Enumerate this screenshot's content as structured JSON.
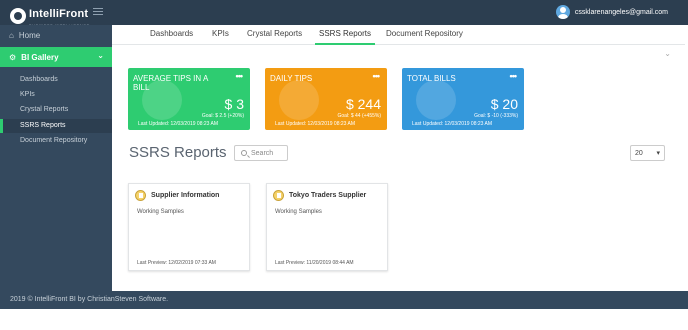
{
  "app": {
    "logo_text": "IntelliFront",
    "logo_sub": "BUSINESS INTELLIGENCE",
    "user_email": "cssklarenangeles@gmail.com"
  },
  "sidebar": {
    "home_label": "Home",
    "gallery_label": "BI Gallery",
    "items": [
      {
        "label": "Dashboards"
      },
      {
        "label": "KPIs"
      },
      {
        "label": "Crystal Reports"
      },
      {
        "label": "SSRS Reports"
      },
      {
        "label": "Document Repository"
      }
    ]
  },
  "tabs": [
    {
      "label": "Dashboards"
    },
    {
      "label": "KPIs"
    },
    {
      "label": "Crystal Reports"
    },
    {
      "label": "SSRS Reports"
    },
    {
      "label": "Document Repository"
    }
  ],
  "kpis": [
    {
      "title": "Average Tips in a Bill",
      "value": "$ 3",
      "goal": "Goal: $ 2.5 (+20%)",
      "updated": "Last Updated: 12/03/2019 08:23 AM",
      "color": "#2ecc71"
    },
    {
      "title": "Daily Tips",
      "value": "$ 244",
      "goal": "Goal: $ 44 (+455%)",
      "updated": "Last Updated: 12/03/2019 08:23 AM",
      "color": "#f39c12"
    },
    {
      "title": "Total Bills",
      "value": "$ 20",
      "goal": "Goal: $ -10 (-333%)",
      "updated": "Last Updated: 12/03/2019 08:23 AM",
      "color": "#3498db"
    }
  ],
  "section": {
    "title": "SSRS Reports",
    "search_placeholder": "Search",
    "page_size": "20"
  },
  "reports": [
    {
      "name": "Supplier Information",
      "description": "Working Samples",
      "last_preview": "Last Preview: 12/02/2019 07:33 AM"
    },
    {
      "name": "Tokyo Traders Supplier",
      "description": "Working Samples",
      "last_preview": "Last Preview: 11/20/2019 08:44 AM"
    }
  ],
  "footer": {
    "text": "2019 © IntelliFront BI by ChristianSteven Software."
  }
}
